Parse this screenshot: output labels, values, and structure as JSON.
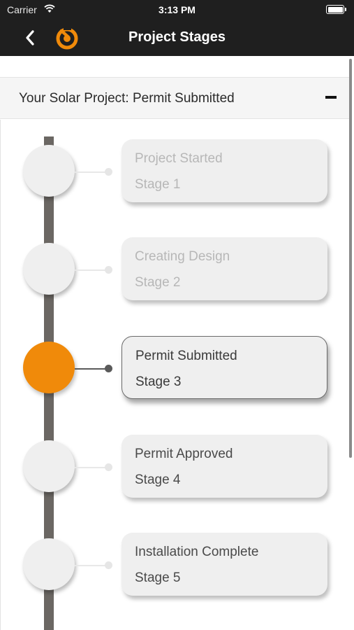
{
  "status_bar": {
    "carrier": "Carrier",
    "time": "3:13 PM",
    "icons": [
      "wifi-icon",
      "battery-icon"
    ]
  },
  "nav": {
    "title": "Project Stages",
    "back_icon": "chevron-left-icon",
    "logo_icon": "power-logo-icon",
    "colors": {
      "bar": "#1f1f1f",
      "logo": "#f08a0a"
    }
  },
  "section": {
    "title": "Your Solar Project: Permit Submitted",
    "toggle_icon": "minus-icon"
  },
  "stages": [
    {
      "name": "Project Started",
      "number": "Stage 1",
      "state": "completed"
    },
    {
      "name": "Creating Design",
      "number": "Stage 2",
      "state": "completed"
    },
    {
      "name": "Permit Submitted",
      "number": "Stage 3",
      "state": "current"
    },
    {
      "name": "Permit Approved",
      "number": "Stage 4",
      "state": "pending"
    },
    {
      "name": "Installation Complete",
      "number": "Stage 5",
      "state": "pending"
    }
  ],
  "colors": {
    "accent": "#f08a0a",
    "timeline": "#6b6763",
    "card": "#efefef"
  }
}
